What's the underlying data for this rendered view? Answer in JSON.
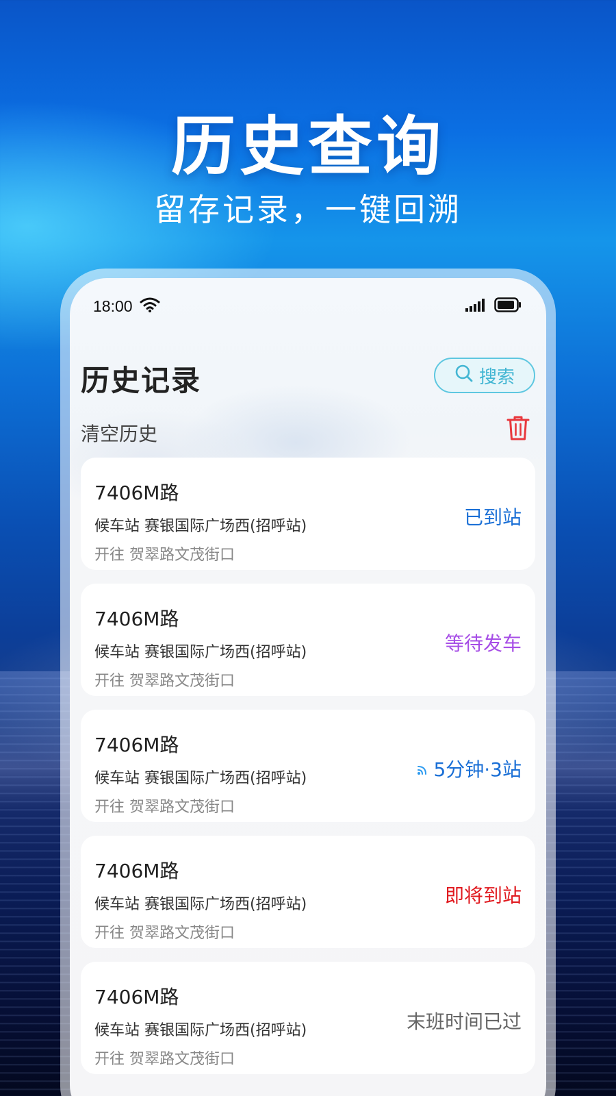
{
  "hero": {
    "title": "历史查询",
    "subtitle": "留存记录，一键回溯"
  },
  "status_bar": {
    "time": "18:00",
    "icons": [
      "wifi-icon",
      "signal-icon",
      "battery-icon"
    ]
  },
  "header": {
    "title": "历史记录",
    "search_label": "搜索",
    "search_icon": "search-icon"
  },
  "clear_history": {
    "label": "清空历史",
    "icon": "trash-icon"
  },
  "colors": {
    "accent": "#43b6d3",
    "arrived": "#1a6fd6",
    "waiting": "#a64de6",
    "eta": "#1a6fd6",
    "arriving_soon": "#e0191e",
    "last_bus_passed": "#666666",
    "trash": "#e8383d"
  },
  "history": [
    {
      "route": "7406M路",
      "stop": "候车站 赛银国际广场西(招呼站)",
      "destination": "开往 贺翠路文茂街口",
      "status": "已到站",
      "status_type": "arrived"
    },
    {
      "route": "7406M路",
      "stop": "候车站 赛银国际广场西(招呼站)",
      "destination": "开往 贺翠路文茂街口",
      "status": "等待发车",
      "status_type": "waiting"
    },
    {
      "route": "7406M路",
      "stop": "候车站 赛银国际广场西(招呼站)",
      "destination": "开往 贺翠路文茂街口",
      "status": "5分钟·3站",
      "status_type": "eta",
      "status_icon": "realtime-signal-icon"
    },
    {
      "route": "7406M路",
      "stop": "候车站 赛银国际广场西(招呼站)",
      "destination": "开往 贺翠路文茂街口",
      "status": "即将到站",
      "status_type": "arriving_soon"
    },
    {
      "route": "7406M路",
      "stop": "候车站 赛银国际广场西(招呼站)",
      "destination": "开往 贺翠路文茂街口",
      "status": "末班时间已过",
      "status_type": "last_bus_passed"
    }
  ]
}
